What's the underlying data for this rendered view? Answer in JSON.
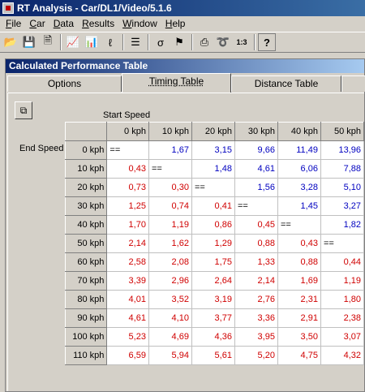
{
  "window": {
    "title": "RT Analysis - Car/DL1/Video/5.1.6"
  },
  "menu": [
    "File",
    "Car",
    "Data",
    "Results",
    "Window",
    "Help"
  ],
  "toolbar": {
    "icons": [
      "open-folder-icon",
      "save-icon",
      "save-as-icon",
      "graph-icon",
      "bar-chart-icon",
      "lap-icon",
      "list-icon",
      "sigma-icon",
      "finish-flag-icon",
      "print-icon",
      "track-icon",
      "table-number-icon",
      "help-icon"
    ]
  },
  "panel": {
    "title": "Calculated Performance Table",
    "tabs": [
      "Options",
      "Timing Table",
      "Distance Table"
    ],
    "active_tab": "Timing Table"
  },
  "table": {
    "start_speed_label": "Start Speed",
    "end_speed_label": "End Speed",
    "columns": [
      "0 kph",
      "10 kph",
      "20 kph",
      "30 kph",
      "40 kph",
      "50 kph"
    ],
    "rows": [
      {
        "label": "0 kph",
        "cells": [
          "==",
          "1,67",
          "3,15",
          "9,66",
          "11,49",
          "13,96"
        ]
      },
      {
        "label": "10 kph",
        "cells": [
          "0,43",
          "==",
          "1,48",
          "4,61",
          "6,06",
          "7,88"
        ]
      },
      {
        "label": "20 kph",
        "cells": [
          "0,73",
          "0,30",
          "==",
          "1,56",
          "3,28",
          "5,10"
        ]
      },
      {
        "label": "30 kph",
        "cells": [
          "1,25",
          "0,74",
          "0,41",
          "==",
          "1,45",
          "3,27"
        ]
      },
      {
        "label": "40 kph",
        "cells": [
          "1,70",
          "1,19",
          "0,86",
          "0,45",
          "==",
          "1,82"
        ]
      },
      {
        "label": "50 kph",
        "cells": [
          "2,14",
          "1,62",
          "1,29",
          "0,88",
          "0,43",
          "=="
        ]
      },
      {
        "label": "60 kph",
        "cells": [
          "2,58",
          "2,08",
          "1,75",
          "1,33",
          "0,88",
          "0,44"
        ]
      },
      {
        "label": "70 kph",
        "cells": [
          "3,39",
          "2,96",
          "2,64",
          "2,14",
          "1,69",
          "1,19"
        ]
      },
      {
        "label": "80 kph",
        "cells": [
          "4,01",
          "3,52",
          "3,19",
          "2,76",
          "2,31",
          "1,80"
        ]
      },
      {
        "label": "90 kph",
        "cells": [
          "4,61",
          "4,10",
          "3,77",
          "3,36",
          "2,91",
          "2,38"
        ]
      },
      {
        "label": "100 kph",
        "cells": [
          "5,23",
          "4,69",
          "4,36",
          "3,95",
          "3,50",
          "3,07"
        ]
      },
      {
        "label": "110 kph",
        "cells": [
          "6,59",
          "5,94",
          "5,61",
          "5,20",
          "4,75",
          "4,32"
        ]
      }
    ],
    "colors": {
      "decel": "#d00000",
      "accel": "#0000c0"
    }
  }
}
